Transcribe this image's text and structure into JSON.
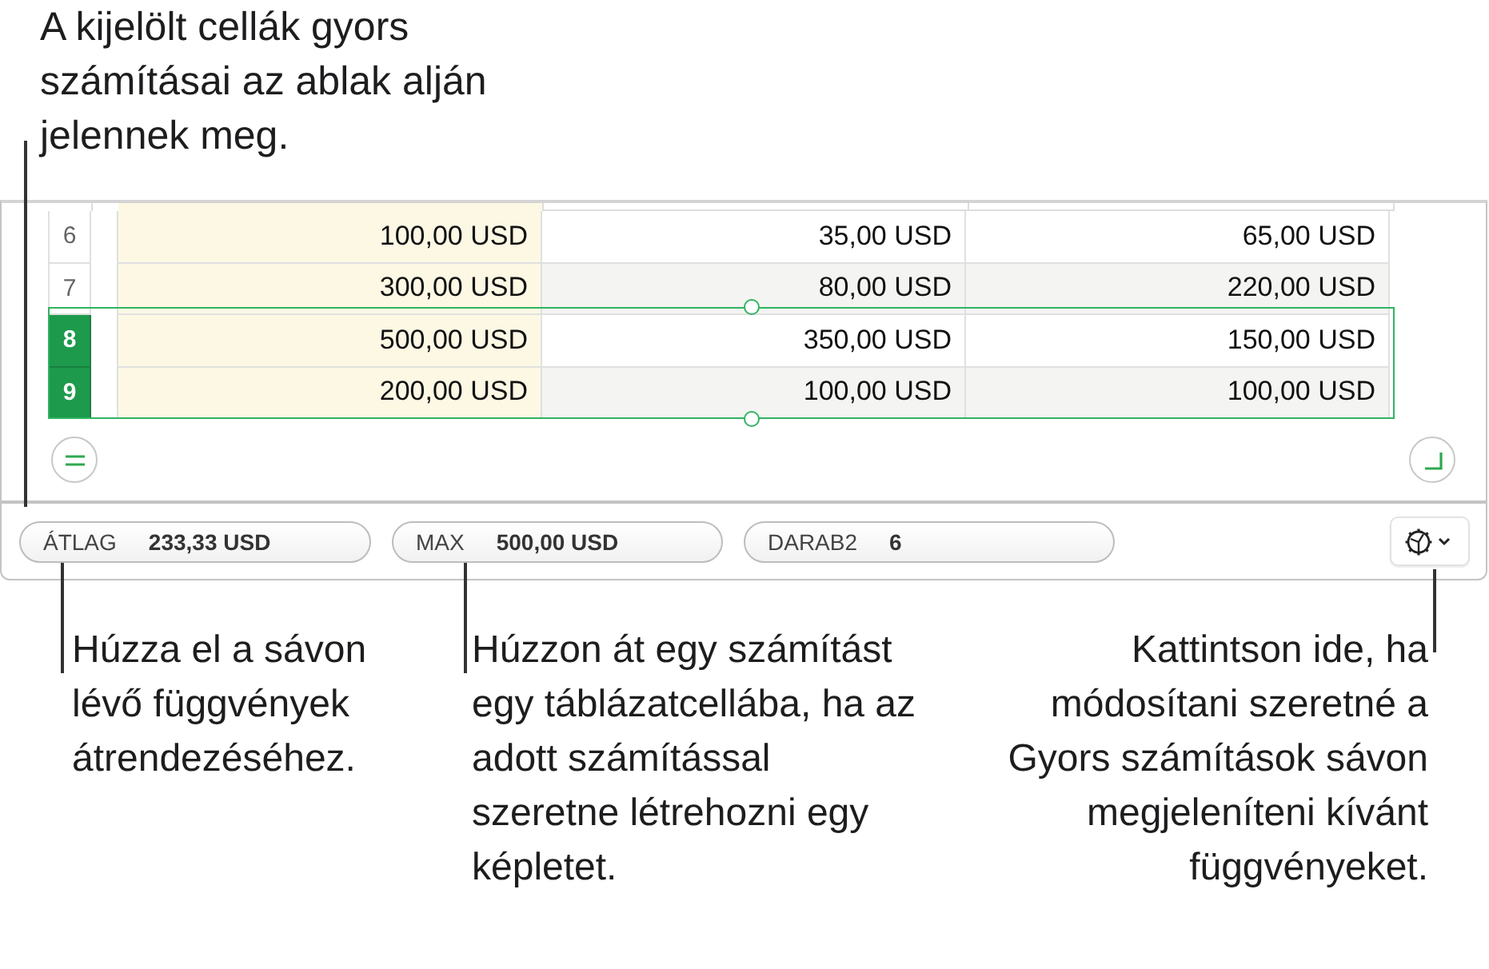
{
  "top_callout": "A kijelölt cellák gyors számításai az ablak alján jelennek meg.",
  "rows": [
    {
      "number": "6",
      "selected": false,
      "cells": [
        "100,00 USD",
        "35,00 USD",
        "65,00 USD"
      ]
    },
    {
      "number": "7",
      "selected": false,
      "cells": [
        "300,00 USD",
        "80,00 USD",
        "220,00 USD"
      ]
    },
    {
      "number": "8",
      "selected": true,
      "cells": [
        "500,00 USD",
        "350,00 USD",
        "150,00 USD"
      ]
    },
    {
      "number": "9",
      "selected": true,
      "cells": [
        "200,00 USD",
        "100,00 USD",
        "100,00 USD"
      ]
    }
  ],
  "quick_calcs": [
    {
      "label": "ÁTLAG",
      "value": "233,33 USD"
    },
    {
      "label": "MAX",
      "value": "500,00 USD"
    },
    {
      "label": "DARAB2",
      "value": "6"
    }
  ],
  "bottom_callouts": [
    "Húzza el a sávon lévő függvények átrendezéséhez.",
    "Húzzon át egy számítást egy táblázatcellába, ha az adott számítással szeretne létrehozni egy képletet.",
    "Kattintson ide, ha módosítani szeretné a Gyors számítások sávon megjeleníteni kívánt függvényeket."
  ]
}
